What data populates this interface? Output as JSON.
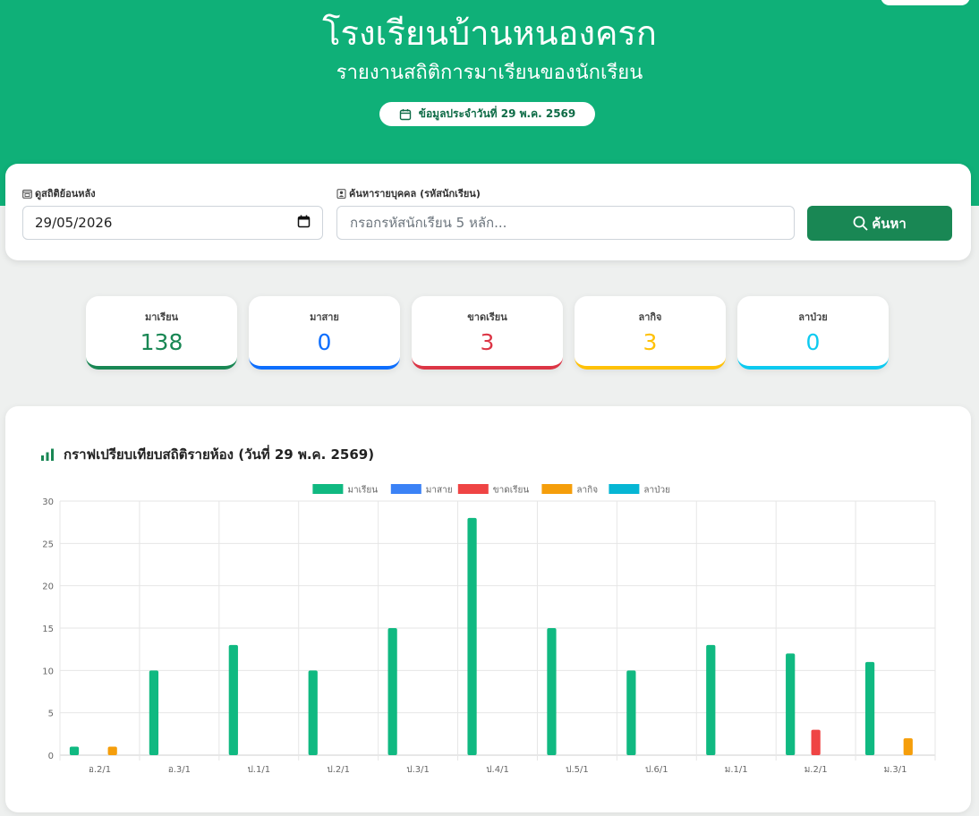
{
  "header": {
    "school_name": "โรงเรียนบ้านหนองครก",
    "subtitle": "รายงานสถิติการมาเรียนของนักเรียน",
    "date_text": "ข้อมูลประจำวันที่ 29 พ.ค. 2569",
    "calendar_icon": "calendar-icon"
  },
  "filters": {
    "date_label": "ดูสถิติย้อนหลัง",
    "date_value": "29/05/2026",
    "search_label": "ค้นหารายบุคคล (รหัสนักเรียน)",
    "search_placeholder": "กรอกรหัสนักเรียน 5 หลัก...",
    "search_value": "",
    "search_button": "ค้นหา"
  },
  "stats": [
    {
      "label": "มาเรียน",
      "value": "138",
      "color": "#198754"
    },
    {
      "label": "มาสาย",
      "value": "0",
      "color": "#0d6efd"
    },
    {
      "label": "ขาดเรียน",
      "value": "3",
      "color": "#dc3545"
    },
    {
      "label": "ลากิจ",
      "value": "3",
      "color": "#ffc107"
    },
    {
      "label": "ลาป่วย",
      "value": "0",
      "color": "#0dcaf0"
    }
  ],
  "chart": {
    "heading": "กราฟเปรียบเทียบสถิติรายห้อง (วันที่ 29 พ.ค. 2569)"
  },
  "chart_data": {
    "type": "bar",
    "categories": [
      "อ.2/1",
      "อ.3/1",
      "ป.1/1",
      "ป.2/1",
      "ป.3/1",
      "ป.4/1",
      "ป.5/1",
      "ป.6/1",
      "ม.1/1",
      "ม.2/1",
      "ม.3/1"
    ],
    "series": [
      {
        "name": "มาเรียน",
        "color": "#10b981",
        "values": [
          1,
          10,
          13,
          10,
          15,
          28,
          15,
          10,
          13,
          12,
          11
        ]
      },
      {
        "name": "มาสาย",
        "color": "#3b82f6",
        "values": [
          0,
          0,
          0,
          0,
          0,
          0,
          0,
          0,
          0,
          0,
          0
        ]
      },
      {
        "name": "ขาดเรียน",
        "color": "#ef4444",
        "values": [
          0,
          0,
          0,
          0,
          0,
          0,
          0,
          0,
          0,
          3,
          0
        ]
      },
      {
        "name": "ลากิจ",
        "color": "#f59e0b",
        "values": [
          1,
          0,
          0,
          0,
          0,
          0,
          0,
          0,
          0,
          0,
          2
        ]
      },
      {
        "name": "ลาป่วย",
        "color": "#06b6d4",
        "values": [
          0,
          0,
          0,
          0,
          0,
          0,
          0,
          0,
          0,
          0,
          0
        ]
      }
    ],
    "yticks": [
      0,
      5,
      10,
      15,
      20,
      25,
      30
    ],
    "ylim": [
      0,
      30
    ],
    "grid": true,
    "legend": "top-center"
  }
}
